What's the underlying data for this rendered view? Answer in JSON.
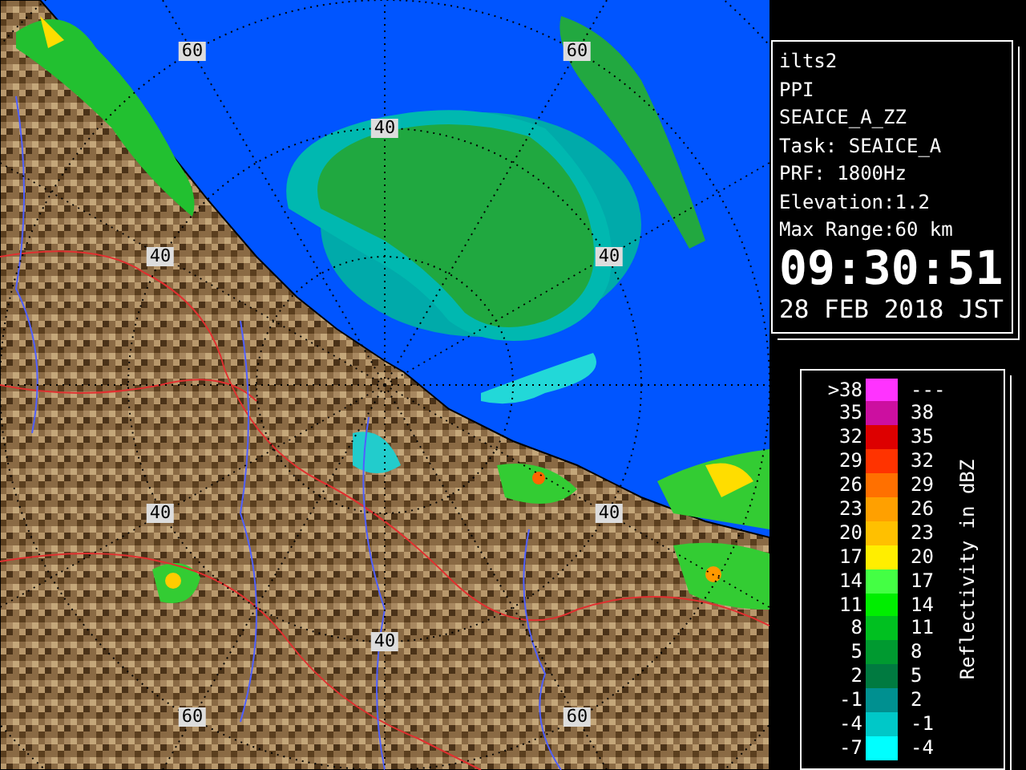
{
  "radar_map": {
    "range_labels": [
      "60",
      "60",
      "40",
      "40",
      "40",
      "40",
      "40",
      "40",
      "60",
      "60"
    ]
  },
  "info_panel": {
    "lines": [
      "ilts2",
      "PPI",
      "SEAICE_A_ZZ",
      "Task: SEAICE_A",
      "PRF: 1800Hz",
      "Elevation:1.2",
      "Max Range:60 km"
    ],
    "time": "09:30:51",
    "date": "28 FEB 2018 JST"
  },
  "legend": {
    "title": "Reflectivity in dBZ",
    "rows": [
      {
        "lower": ">38",
        "upper": "---",
        "color": "#ff33ff"
      },
      {
        "lower": "35",
        "upper": "38",
        "color": "#cc0fa0"
      },
      {
        "lower": "32",
        "upper": "35",
        "color": "#dd0000"
      },
      {
        "lower": "29",
        "upper": "32",
        "color": "#ff3300"
      },
      {
        "lower": "26",
        "upper": "29",
        "color": "#ff7000"
      },
      {
        "lower": "23",
        "upper": "26",
        "color": "#ffa000"
      },
      {
        "lower": "20",
        "upper": "23",
        "color": "#ffc000"
      },
      {
        "lower": "17",
        "upper": "20",
        "color": "#ffee00"
      },
      {
        "lower": "14",
        "upper": "17",
        "color": "#44ff44"
      },
      {
        "lower": "11",
        "upper": "14",
        "color": "#00ee00"
      },
      {
        "lower": "8",
        "upper": "11",
        "color": "#00c020"
      },
      {
        "lower": "5",
        "upper": "8",
        "color": "#009a30"
      },
      {
        "lower": "2",
        "upper": "5",
        "color": "#007a40"
      },
      {
        "lower": "-1",
        "upper": "2",
        "color": "#009090"
      },
      {
        "lower": "-4",
        "upper": "-1",
        "color": "#00c8c8"
      },
      {
        "lower": "-7",
        "upper": "-4",
        "color": "#00ffff"
      }
    ]
  }
}
